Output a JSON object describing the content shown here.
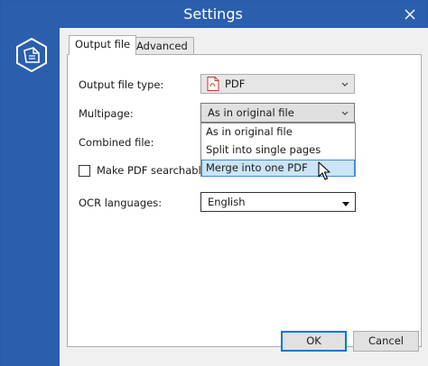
{
  "window": {
    "title": "Settings"
  },
  "tabs": [
    {
      "label": "Output file",
      "active": true
    },
    {
      "label": "Advanced",
      "active": false
    }
  ],
  "form": {
    "output_file_type": {
      "label": "Output file type:",
      "value": "PDF",
      "icon": "pdf-file-icon"
    },
    "multipage": {
      "label": "Multipage:",
      "value": "As in original file",
      "options": [
        "As in original file",
        "Split into single pages",
        "Merge into one PDF"
      ],
      "highlighted_index": 2
    },
    "combined_file": {
      "label": "Combined file:"
    },
    "make_pdf_searchable": {
      "label": "Make PDF searchable",
      "checked": false
    },
    "ocr_languages": {
      "label": "OCR languages:",
      "value": "English"
    }
  },
  "buttons": {
    "ok": "OK",
    "cancel": "Cancel"
  },
  "colors": {
    "accent": "#2b5fad",
    "highlight": "#cce4f7",
    "focus_border": "#0078d7"
  }
}
